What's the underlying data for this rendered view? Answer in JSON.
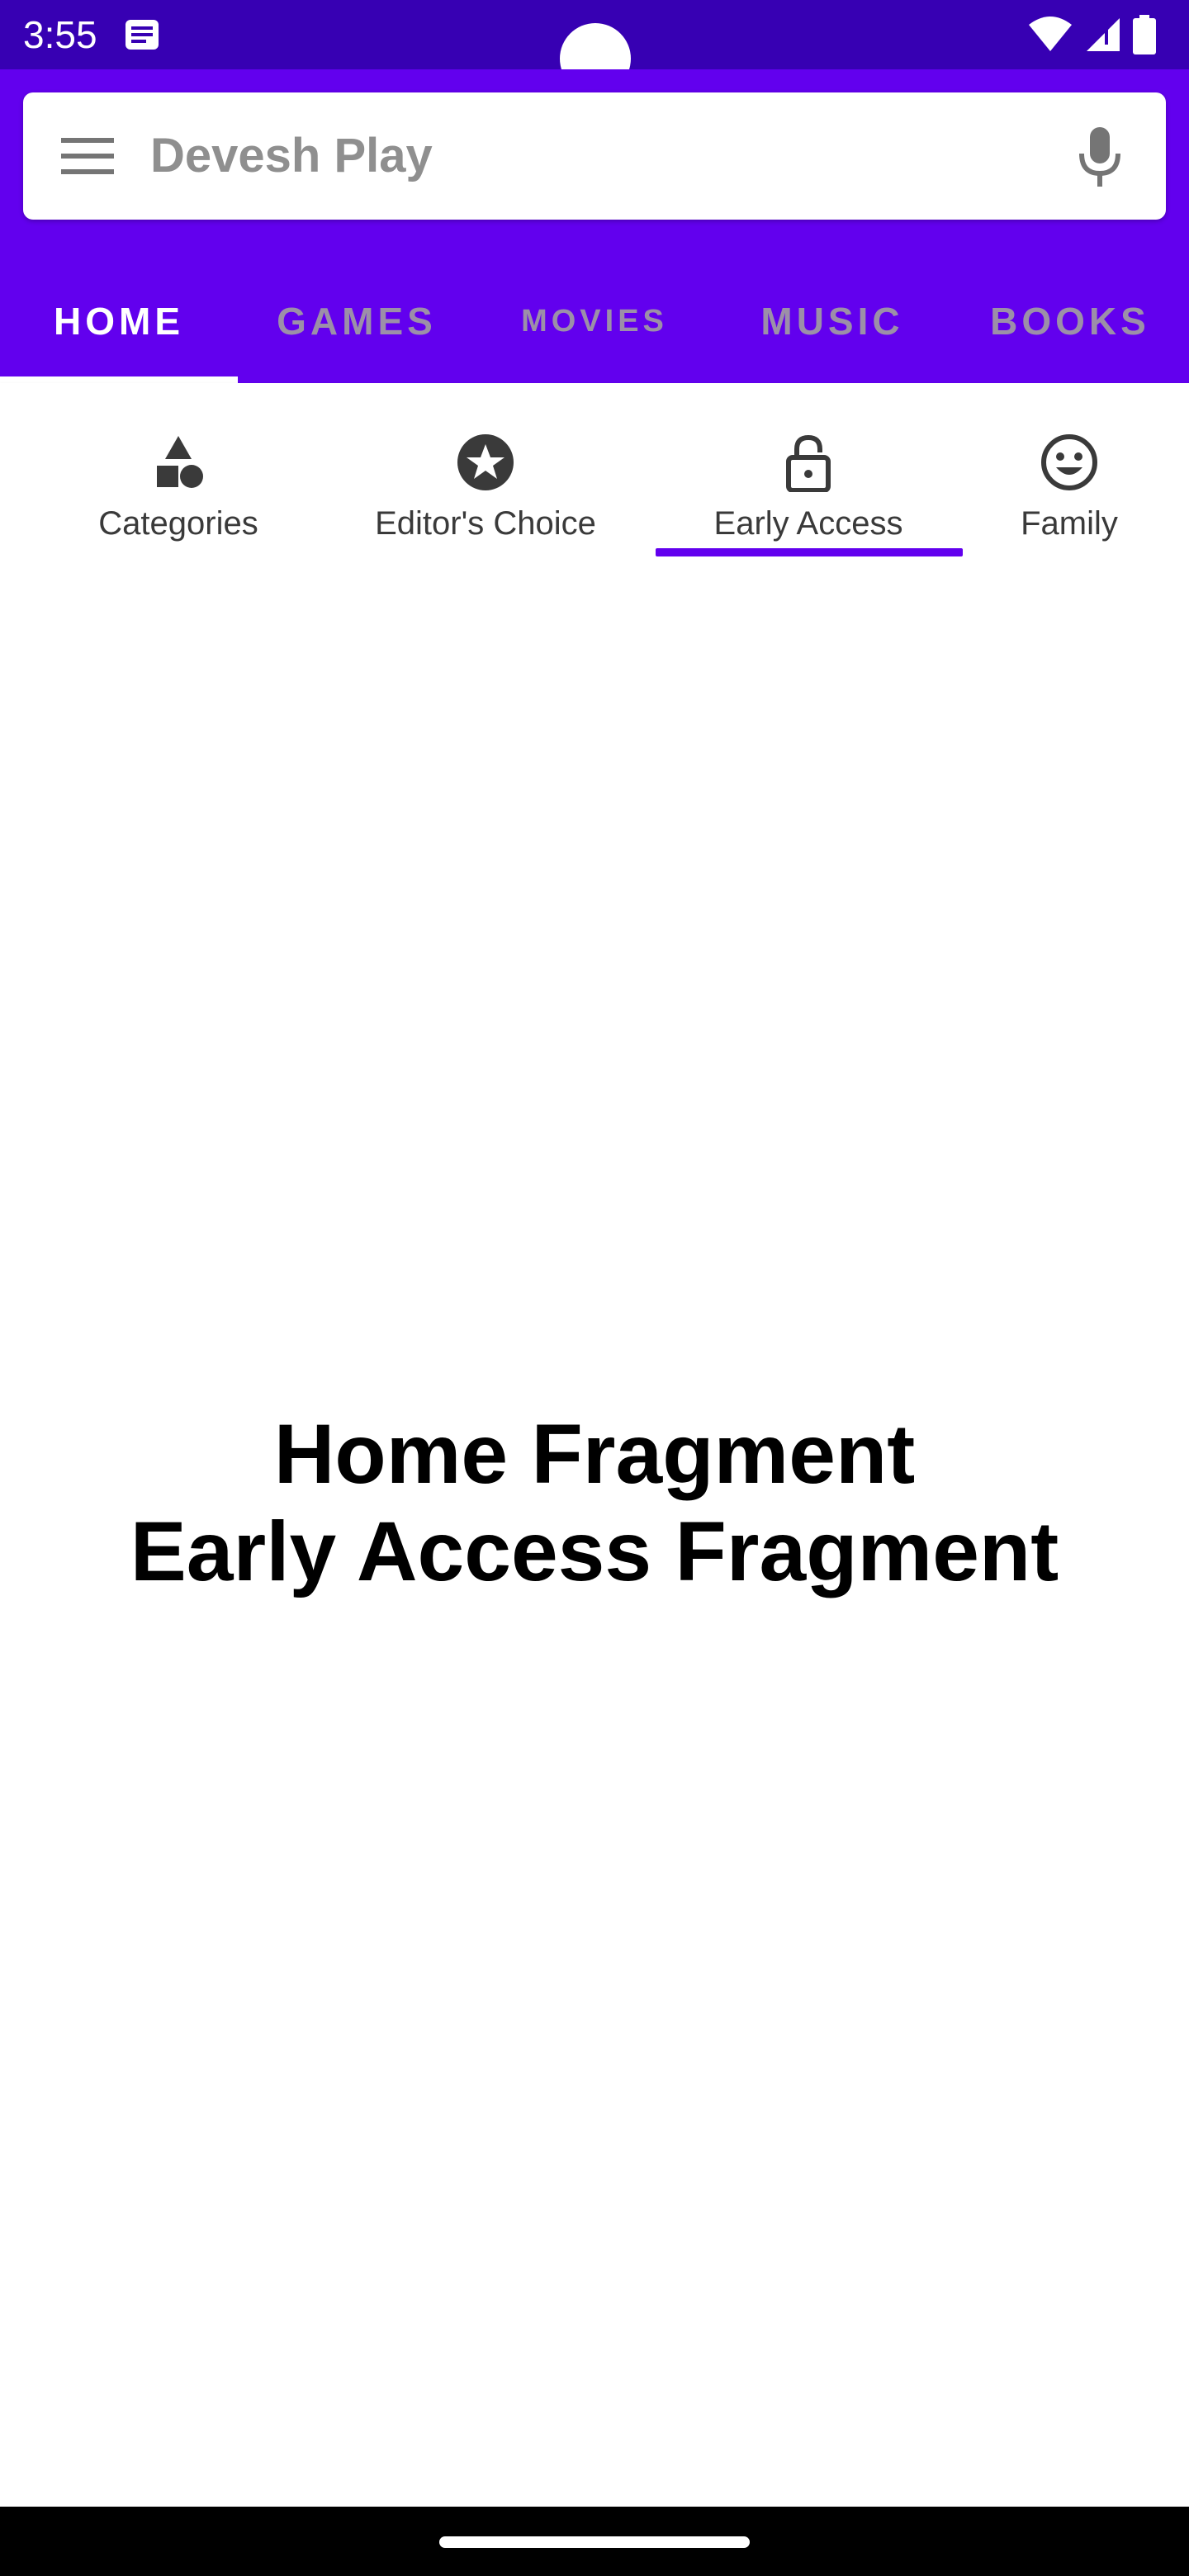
{
  "status_bar": {
    "time": "3:55",
    "icons": [
      "notification-icon",
      "wifi-icon",
      "signal-icon",
      "battery-icon"
    ],
    "background": "#3700b3"
  },
  "search": {
    "title": "Devesh Play",
    "menu_icon": "hamburger-menu-icon",
    "mic_icon": "mic-icon"
  },
  "top_tabs": [
    {
      "label": "HOME",
      "active": true
    },
    {
      "label": "GAMES",
      "active": false
    },
    {
      "label": "MOVIES",
      "active": false
    },
    {
      "label": "MUSIC",
      "active": false
    },
    {
      "label": "BOOKS",
      "active": false
    }
  ],
  "sub_tabs": [
    {
      "label": "Categories",
      "icon": "shapes-icon",
      "active": false
    },
    {
      "label": "Editor's Choice",
      "icon": "star-badge-icon",
      "active": false
    },
    {
      "label": "Early Access",
      "icon": "lock-open-icon",
      "active": true
    },
    {
      "label": "Family",
      "icon": "smiley-face-icon",
      "active": false
    }
  ],
  "content": {
    "line1": "Home Fragment",
    "line2": "Early Access Fragment"
  },
  "colors": {
    "primary": "#6200ee",
    "primary_dark": "#3700b3",
    "inactive_tab": "#9c8fa8",
    "icon_gray": "#3a3a3a"
  }
}
